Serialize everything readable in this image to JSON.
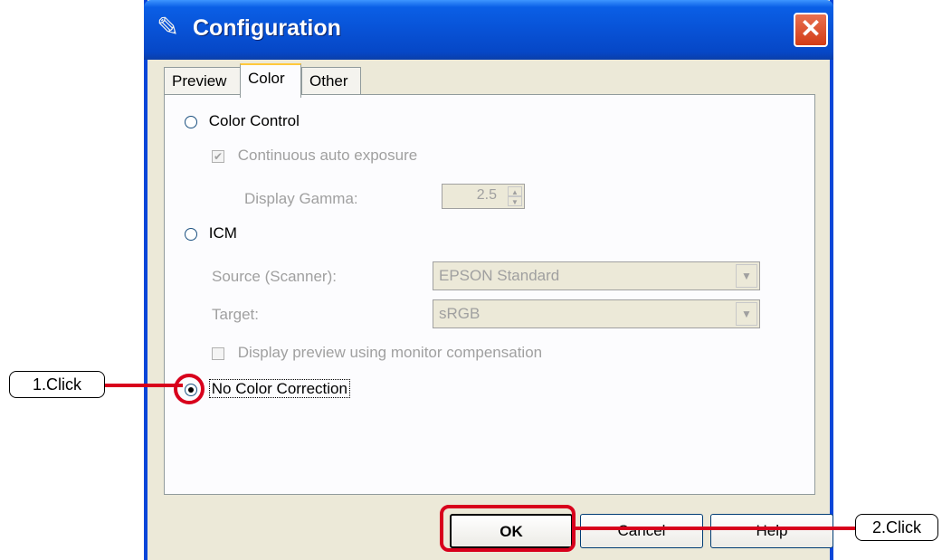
{
  "window": {
    "title": "Configuration",
    "close_glyph": "✕",
    "title_icon": "scanner-icon"
  },
  "tabs": [
    {
      "label": "Preview",
      "active": false
    },
    {
      "label": "Color",
      "active": true
    },
    {
      "label": "Other",
      "active": false
    }
  ],
  "color_tab": {
    "color_control": {
      "label": "Color Control",
      "selected": false
    },
    "continuous_auto_exposure": {
      "label": "Continuous auto exposure",
      "checked": true,
      "disabled": true
    },
    "display_gamma": {
      "label": "Display Gamma:",
      "value": "2.5",
      "disabled": true
    },
    "icm": {
      "label": "ICM",
      "selected": false
    },
    "source": {
      "label": "Source (Scanner):",
      "value": "EPSON Standard",
      "disabled": true
    },
    "target": {
      "label": "Target:",
      "value": "sRGB",
      "disabled": true
    },
    "display_preview": {
      "label": "Display preview using monitor compensation",
      "checked": false,
      "disabled": true
    },
    "no_color_correction": {
      "label": "No Color Correction",
      "selected": true
    }
  },
  "buttons": {
    "ok": "OK",
    "cancel": "Cancel",
    "help": "Help"
  },
  "annotations": {
    "step1": "1.Click",
    "step2": "2.Click",
    "highlight_color": "#d8001c"
  }
}
